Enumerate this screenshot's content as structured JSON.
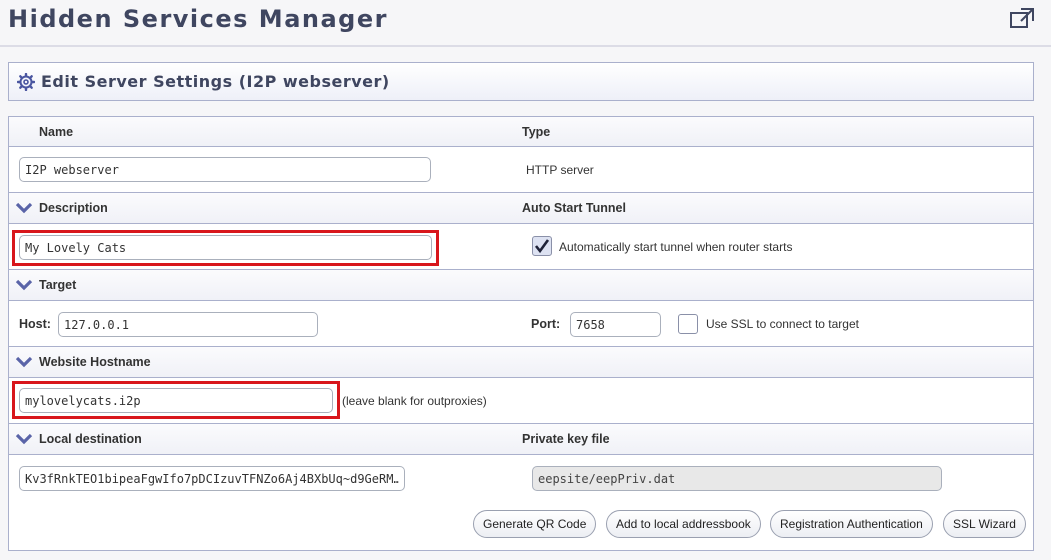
{
  "page": {
    "title": "Hidden Services Manager"
  },
  "panel": {
    "title": "Edit Server Settings (I2P webserver)"
  },
  "form": {
    "name": {
      "label": "Name",
      "value": "I2P webserver"
    },
    "type": {
      "label": "Type",
      "value": "HTTP server"
    },
    "description": {
      "label": "Description",
      "value": "My Lovely Cats"
    },
    "auto_start": {
      "label": "Auto Start Tunnel",
      "checkbox_label": "Automatically start tunnel when router starts",
      "checked": true
    },
    "target": {
      "label": "Target",
      "host_label": "Host:",
      "host_value": "127.0.0.1",
      "port_label": "Port:",
      "port_value": "7658",
      "ssl_label": "Use SSL to connect to target",
      "ssl_checked": false
    },
    "hostname": {
      "label": "Website Hostname",
      "value": "mylovelycats.i2p",
      "hint": "(leave blank for outproxies)"
    },
    "local_destination": {
      "label": "Local destination",
      "value": "Kv3fRnkTEO1bipeaFgwIfo7pDCIzuvTFNZo6Aj4BXbUq~d9GeRM…"
    },
    "private_key": {
      "label": "Private key file",
      "value": "eepsite/eepPriv.dat"
    }
  },
  "buttons": {
    "qr": "Generate QR Code",
    "addressbook": "Add to local addressbook",
    "registration": "Registration Authentication",
    "ssl_wizard": "SSL Wizard"
  },
  "icons": {
    "popout": "external-link-icon",
    "settings": "gear-icon",
    "collapse": "chevron-down-icon",
    "check": "check-icon"
  },
  "colors": {
    "title": "#3f4660",
    "border": "#aab0cc",
    "highlight": "#d8161c",
    "chevron": "#5a64a8"
  }
}
